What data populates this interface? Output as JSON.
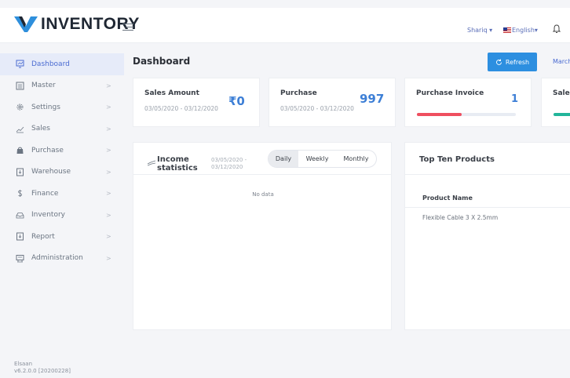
{
  "header": {
    "logo_text": "INVENTORY",
    "user": "Shariq",
    "language": "English"
  },
  "sidebar": {
    "items": [
      {
        "label": "Dashboard",
        "icon": "monitor-icon",
        "active": true
      },
      {
        "label": "Master",
        "icon": "list-icon"
      },
      {
        "label": "Settings",
        "icon": "gear-icon"
      },
      {
        "label": "Sales",
        "icon": "trend-icon"
      },
      {
        "label": "Purchase",
        "icon": "bag-icon"
      },
      {
        "label": "Warehouse",
        "icon": "box-icon"
      },
      {
        "label": "Finance",
        "icon": "dollar-icon"
      },
      {
        "label": "Inventory",
        "icon": "tray-icon"
      },
      {
        "label": "Report",
        "icon": "report-icon"
      },
      {
        "label": "Administration",
        "icon": "admin-icon"
      }
    ],
    "chevron": ">"
  },
  "footer": {
    "company": "Elsaan",
    "version": "v6.2.0.0 [20200228]"
  },
  "page": {
    "title": "Dashboard",
    "refresh_label": "Refresh",
    "march_label": "March"
  },
  "kpis": {
    "sales_amount": {
      "label": "Sales Amount",
      "date": "03/05/2020 - 03/12/2020",
      "value": "₹0"
    },
    "purchase": {
      "label": "Purchase",
      "date": "03/05/2020 - 03/12/2020",
      "value": "997"
    },
    "purchase_invoice": {
      "label": "Purchase Invoice",
      "value": "1",
      "progress": 0.45,
      "color": "#ef4f5f"
    },
    "sales_partial": {
      "label": "Sales",
      "color": "#22b59a"
    }
  },
  "income": {
    "title_line1": "Income",
    "title_line2": "statistics",
    "date_line1": "03/05/2020 -",
    "date_line2": "03/12/2020",
    "tabs": [
      "Daily",
      "Weekly",
      "Monthly"
    ],
    "active_tab": "Daily",
    "empty_text": "No data"
  },
  "top_products": {
    "title": "Top Ten Products",
    "column": "Product Name",
    "rows": [
      "Flexible Cable 3 X 2.5mm"
    ]
  },
  "colors": {
    "accent": "#2d8fe0",
    "active_nav_bg": "#e6ebf9",
    "value_blue": "#3d7fd6"
  }
}
